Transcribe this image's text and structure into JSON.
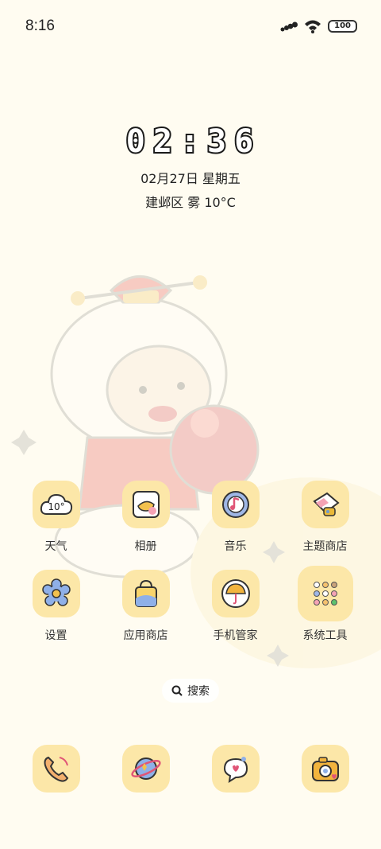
{
  "status_bar": {
    "time": "8:16",
    "battery": "100"
  },
  "clock": {
    "digits": [
      "0",
      "2",
      ":",
      "3",
      "6"
    ],
    "date": "02月27日 星期五",
    "weather": "建邺区 雾 10°C"
  },
  "apps": [
    {
      "label": "天气",
      "icon": "cloud-10-icon",
      "badge": "10°"
    },
    {
      "label": "相册",
      "icon": "gallery-icon"
    },
    {
      "label": "音乐",
      "icon": "music-disc-icon"
    },
    {
      "label": "主题商店",
      "icon": "theme-store-icon"
    },
    {
      "label": "设置",
      "icon": "gear-flower-icon"
    },
    {
      "label": "应用商店",
      "icon": "shopping-bag-icon"
    },
    {
      "label": "手机管家",
      "icon": "umbrella-icon"
    },
    {
      "label": "系统工具",
      "icon": "folder-grid-icon"
    }
  ],
  "search": {
    "label": "搜索"
  },
  "dock": [
    {
      "icon": "phone-icon"
    },
    {
      "icon": "planet-icon"
    },
    {
      "icon": "message-bubble-icon"
    },
    {
      "icon": "camera-icon"
    }
  ],
  "colors": {
    "background": "#FFFCF1",
    "icon_tile": "#FCE7A8"
  }
}
